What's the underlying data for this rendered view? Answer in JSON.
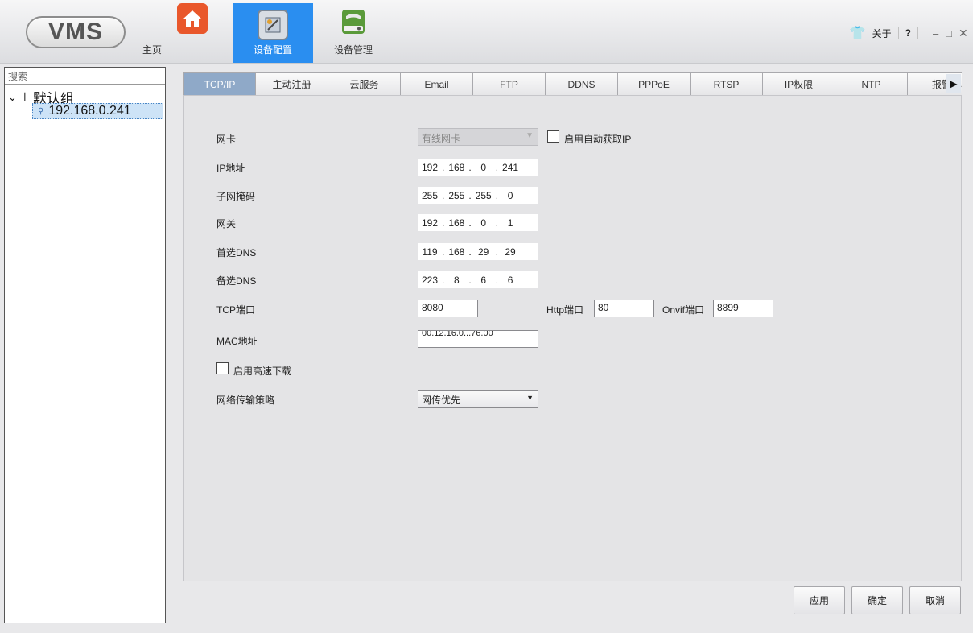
{
  "app": {
    "logo_text": "VMS",
    "nav": {
      "home": "主页",
      "config": "设备配置",
      "manage": "设备管理"
    },
    "topright": {
      "about": "关于",
      "help": "?",
      "minimize": "–",
      "maximize": "□",
      "close": "✕"
    }
  },
  "sidebar": {
    "search_placeholder": "搜索",
    "group": "默认组",
    "device": "192.168.0.241"
  },
  "tabs": [
    "TCP/IP",
    "主动注册",
    "云服务",
    "Email",
    "FTP",
    "DDNS",
    "PPPoE",
    "RTSP",
    "IP权限",
    "NTP",
    "报警中心"
  ],
  "active_tab": "TCP/IP",
  "form": {
    "nic_label": "网卡",
    "nic_value": "有线网卡",
    "dhcp_label": "启用自动获取IP",
    "ip_label": "IP地址",
    "ip": [
      "192",
      "168",
      "0",
      "241"
    ],
    "mask_label": "子网掩码",
    "mask": [
      "255",
      "255",
      "255",
      "0"
    ],
    "gateway_label": "网关",
    "gateway": [
      "192",
      "168",
      "0",
      "1"
    ],
    "dns1_label": "首选DNS",
    "dns1": [
      "119",
      "168",
      "29",
      "29"
    ],
    "dns2_label": "备选DNS",
    "dns2": [
      "223",
      "8",
      "6",
      "6"
    ],
    "tcp_port_label": "TCP端口",
    "tcp_port": "8080",
    "http_port_label": "Http端口",
    "http_port": "80",
    "onvif_port_label": "Onvif端口",
    "onvif_port": "8899",
    "mac_label": "MAC地址",
    "mac_value": "00.12.16.0...76.00",
    "highspeed_label": "启用高速下载",
    "strategy_label": "网络传输策略",
    "strategy_value": "网传优先"
  },
  "buttons": {
    "apply": "应用",
    "ok": "确定",
    "cancel": "取消"
  },
  "colors": {
    "nav_active": "#2a8ef0",
    "tab_active": "#8fa9c8",
    "tree_selected": "#cde3f7"
  }
}
